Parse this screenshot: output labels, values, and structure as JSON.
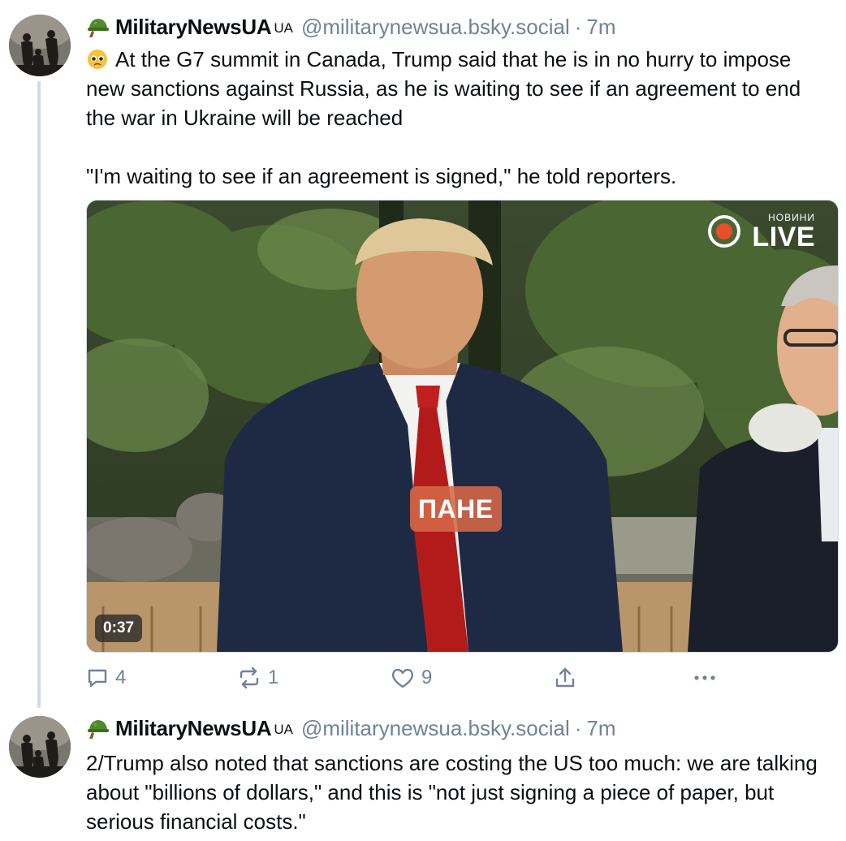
{
  "posts": [
    {
      "author": {
        "display_name": "MilitaryNewsUA",
        "name_suffix": "UA",
        "handle": "@militarynewsua.bsky.social",
        "separator": "·",
        "time": "7m",
        "badge_icon": "helmet-emoji-icon",
        "avatar_icon": "soldiers-avatar"
      },
      "text_lead_icon": "pleading-face-emoji-icon",
      "text": "At the G7 summit in Canada, Trump said that he is in no hurry to impose new sanctions against Russia, as he is waiting to see if an agreement to end the war in Ukraine will be reached\n\n\"I'm waiting to see if an agreement is signed,\" he told reporters.",
      "video": {
        "channel_small": "НОВИНИ",
        "channel_big": "LIVE",
        "caption": "ПАНЕ",
        "duration": "0:37"
      },
      "actions": {
        "reply_count": "4",
        "repost_count": "1",
        "like_count": "9",
        "reply_icon": "reply-icon",
        "repost_icon": "repost-icon",
        "like_icon": "heart-icon",
        "share_icon": "share-icon",
        "more_icon": "more-options-icon"
      }
    },
    {
      "author": {
        "display_name": "MilitaryNewsUA",
        "name_suffix": "UA",
        "handle": "@militarynewsua.bsky.social",
        "separator": "·",
        "time": "7m",
        "badge_icon": "helmet-emoji-icon",
        "avatar_icon": "soldiers-avatar"
      },
      "text": "2/Trump also noted that sanctions are costing the US too much: we are talking about \"billions of dollars,\" and this is \"not just signing a piece of paper, but serious financial costs.\""
    }
  ],
  "colors": {
    "muted": "#6f8399",
    "text": "#0b0f14",
    "thread_line": "#d4dbe2",
    "live_dot": "#e94e2b",
    "caption_bg": "#d66848"
  }
}
